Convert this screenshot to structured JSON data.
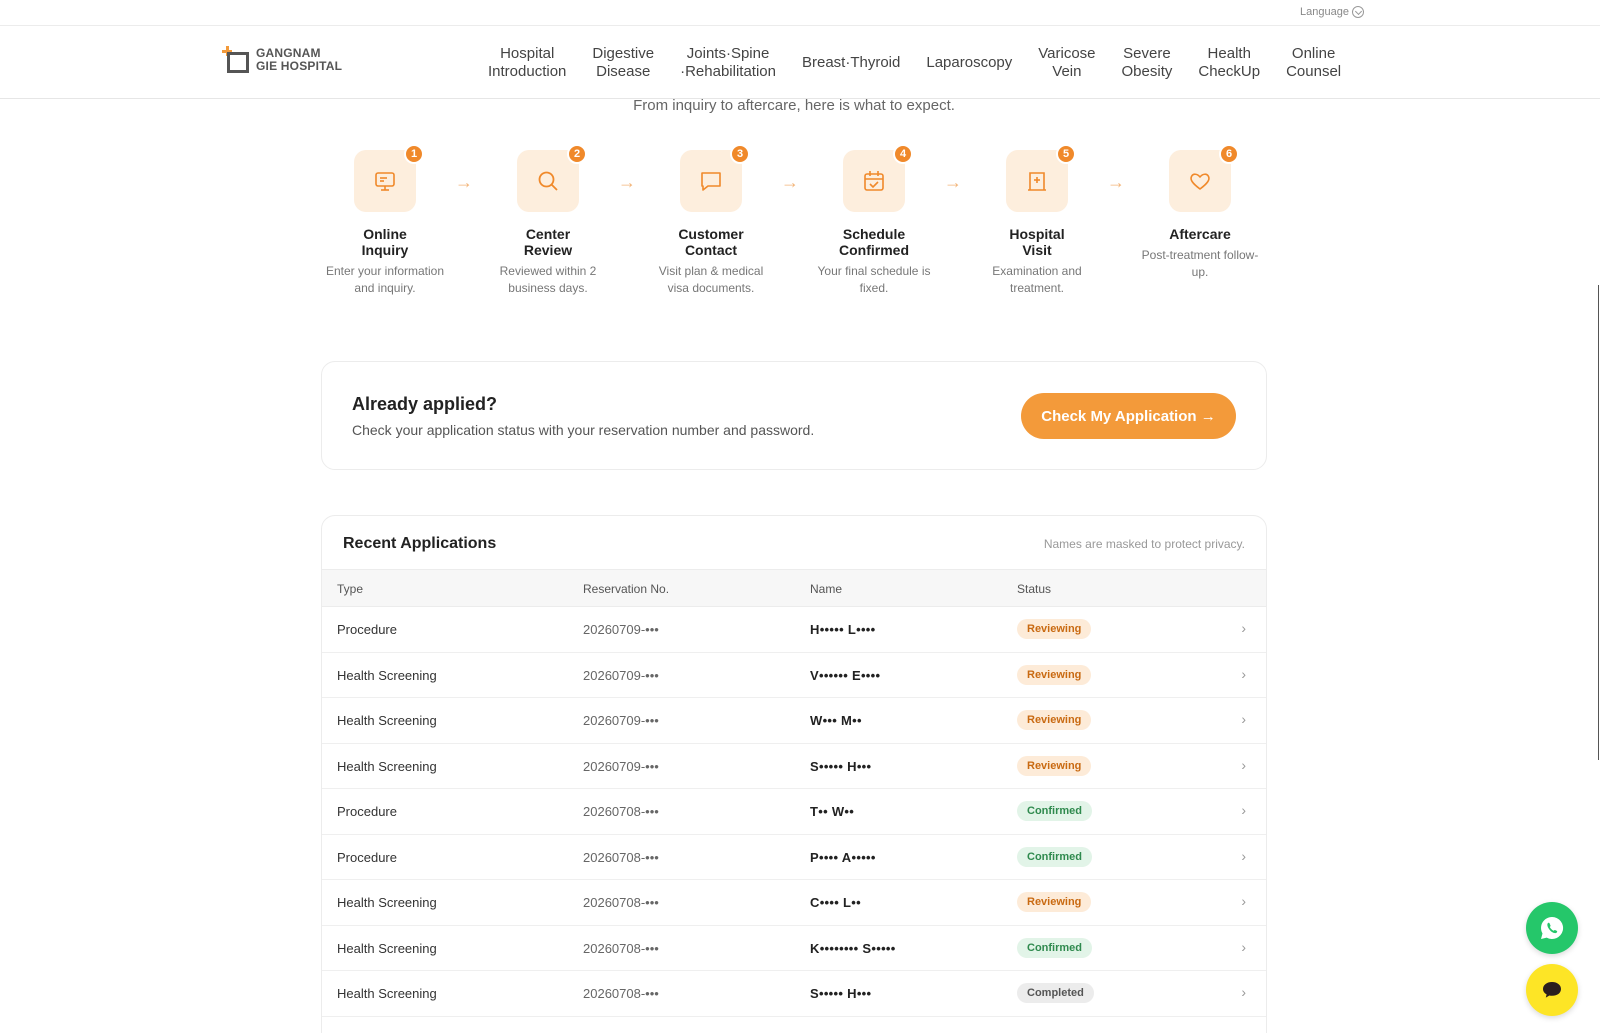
{
  "utility": {
    "language": "Language"
  },
  "logo": {
    "line1": "GANGNAM",
    "line2": "GIE HOSPITAL"
  },
  "nav": [
    "Hospital\nIntroduction",
    "Digestive\nDisease",
    "Joints·Spine\n·Rehabilitation",
    "Breast·Thyroid",
    "Laparoscopy",
    "Varicose\nVein",
    "Severe\nObesity",
    "Health\nCheckUp",
    "Online\nCounsel"
  ],
  "process": {
    "subtitle": "From inquiry to aftercare, here is what to expect.",
    "steps": [
      {
        "num": "1",
        "icon": "monitor-icon",
        "title": "Online Inquiry",
        "desc": "Enter your information and inquiry."
      },
      {
        "num": "2",
        "icon": "search-icon",
        "title": "Center Review",
        "desc": "Reviewed within 2 business days."
      },
      {
        "num": "3",
        "icon": "message-icon",
        "title": "Customer Contact",
        "desc": "Visit plan & medical visa documents."
      },
      {
        "num": "4",
        "icon": "calendar-check-icon",
        "title": "Schedule Confirmed",
        "desc": "Your final schedule is fixed."
      },
      {
        "num": "5",
        "icon": "hospital-icon",
        "title": "Hospital Visit",
        "desc": "Examination and treatment."
      },
      {
        "num": "6",
        "icon": "heart-icon",
        "title": "Aftercare",
        "desc": "Post-treatment follow-up."
      }
    ]
  },
  "applied": {
    "title": "Already applied?",
    "desc": "Check your application status with your reservation number and password.",
    "button": "Check My Application →"
  },
  "recent": {
    "title": "Recent Applications",
    "note": "Names are masked to protect privacy.",
    "headers": {
      "type": "Type",
      "reservation": "Reservation No.",
      "name": "Name",
      "status": "Status"
    },
    "rows": [
      {
        "type": "Procedure",
        "reservation": "20260709-•••",
        "name": "H••••• L••••",
        "status": "Reviewing",
        "status_class": "reviewing"
      },
      {
        "type": "Health Screening",
        "reservation": "20260709-•••",
        "name": "V•••••• E••••",
        "status": "Reviewing",
        "status_class": "reviewing"
      },
      {
        "type": "Health Screening",
        "reservation": "20260709-•••",
        "name": "W••• M••",
        "status": "Reviewing",
        "status_class": "reviewing"
      },
      {
        "type": "Health Screening",
        "reservation": "20260709-•••",
        "name": "S••••• H•••",
        "status": "Reviewing",
        "status_class": "reviewing"
      },
      {
        "type": "Procedure",
        "reservation": "20260708-•••",
        "name": "T•• W••",
        "status": "Confirmed",
        "status_class": "confirmed"
      },
      {
        "type": "Procedure",
        "reservation": "20260708-•••",
        "name": "P•••• A•••••",
        "status": "Confirmed",
        "status_class": "confirmed"
      },
      {
        "type": "Health Screening",
        "reservation": "20260708-•••",
        "name": "C•••• L••",
        "status": "Reviewing",
        "status_class": "reviewing"
      },
      {
        "type": "Health Screening",
        "reservation": "20260708-•••",
        "name": "K•••••••• S•••••",
        "status": "Confirmed",
        "status_class": "confirmed"
      },
      {
        "type": "Health Screening",
        "reservation": "20260708-•••",
        "name": "S••••• H•••",
        "status": "Completed",
        "status_class": "completed"
      }
    ]
  },
  "colors": {
    "accent": "#f39a3a",
    "badge_bg": "#fdeedd",
    "whatsapp": "#25c76a",
    "chat": "#fde526"
  },
  "floating": {
    "whatsapp_icon": "whatsapp-icon",
    "chat_icon": "chat-bubble-icon"
  }
}
